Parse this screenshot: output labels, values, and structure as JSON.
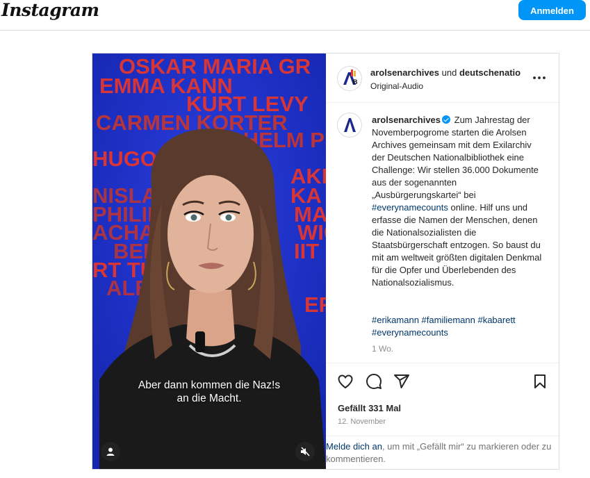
{
  "header": {
    "logo_text": "Instagram",
    "login_button": "Anmelden"
  },
  "media": {
    "names": [
      "OSKAR MARIA GR",
      "EMMA KANN",
      "KURT LEVY",
      "CARMEN KORTER",
      "WILHELM PIECK",
      "HUGO",
      "AKI",
      "NISLAW",
      "KA",
      "PHILIP",
      "MA",
      "ACHAF",
      "WIC",
      "BER",
      "IIT",
      "RT TU",
      "ALB",
      "ER"
    ],
    "subtitle_line1": "Aber dann kommen die Naz!s",
    "subtitle_line2": "an die Macht.",
    "user_tag_icon": "user-icon",
    "mute_icon": "speaker-muted-icon"
  },
  "post": {
    "author": "arolsenarchives",
    "header_connector": "und",
    "coauthor": "deutschenatio",
    "audio": "Original-Audio",
    "caption": "Zum Jahrestag der Novemberpogrome starten die Arolsen Archives gemeinsam mit dem Exilarchiv der Deutschen Nationalbibliothek eine Challenge: Wir stellen 36.000 Dokumente aus der sogenannten „Ausbürgerungskartei“ bei",
    "caption_tag": "#everynamecounts",
    "caption_rest": "online. Hilf uns und erfasse die Namen der Menschen, denen die Nationalsozialisten die Staatsbürgerschaft entzogen. So baust du mit am weltweit größten digitalen Denkmal für die Opfer und Überlebenden des Nationalsozialismus.",
    "hashtags_line1": "#erikamann #familiemann #kabarett",
    "hashtags_line2": "#everynamecounts",
    "age": "1 Wo.",
    "likes": "Gefällt 331 Mal",
    "date": "12. November"
  },
  "login_prompt": {
    "link": "Melde dich an",
    "text": ", um mit „Gefällt mir“ zu markieren oder zu kommentieren."
  },
  "colors": {
    "accent": "#0095f6",
    "media_bg": "#1b2fc9",
    "names_red": "#e8362b",
    "link": "#00376b"
  }
}
